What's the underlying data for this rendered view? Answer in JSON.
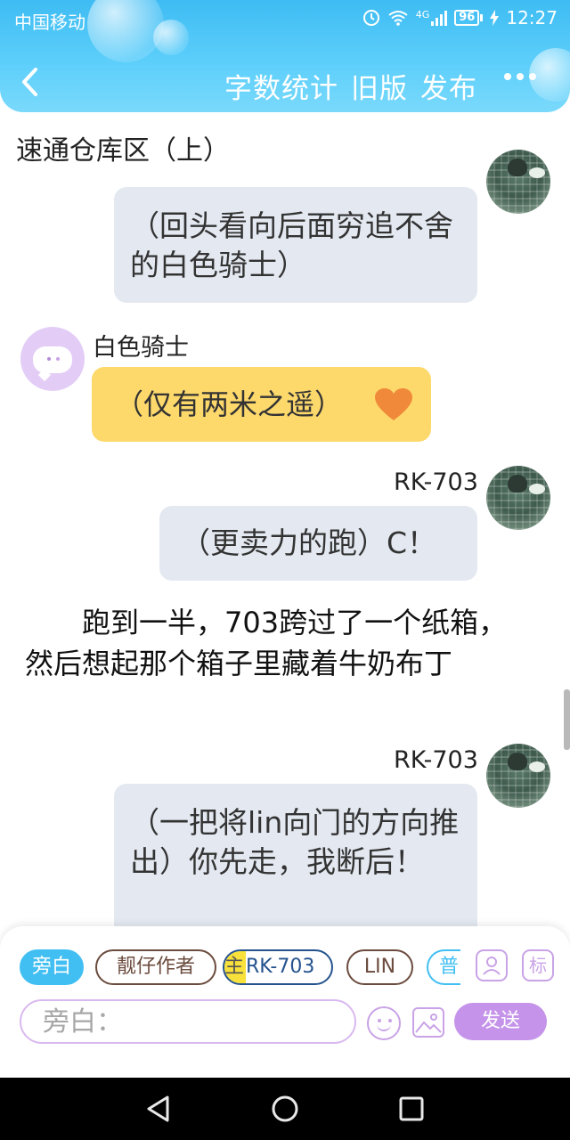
{
  "status_bar": {
    "carrier": "中国移动",
    "network": "4G",
    "battery": "96",
    "time": "12:27"
  },
  "toolbar": {
    "word_count": "字数统计",
    "old_version": "旧版",
    "publish": "发布"
  },
  "chapter_title": "速通仓库区（上）",
  "messages": [
    {
      "speaker": "",
      "text": "（回头看向后面穷追不舍的白色骑士）",
      "side": "right"
    },
    {
      "speaker": "白色骑士",
      "text": "（仅有两米之遥）",
      "emoji": "orange-heart",
      "side": "left"
    },
    {
      "speaker": "RK-703",
      "text": "（更卖力的跑）C！",
      "side": "right"
    }
  ],
  "narration": "跑到一半，703跨过了一个纸箱，然后想起那个箱子里藏着牛奶布丁",
  "last_message": {
    "speaker": "RK-703",
    "text": "（一把将lin向门的方向推出）你先走，我断后！"
  },
  "composer": {
    "roles": [
      "旁白",
      "靓仔作者",
      "RK-703",
      "LIN",
      "普"
    ],
    "main_tag": "主",
    "tool_tag": "标",
    "input_placeholder": "旁白：",
    "send_label": "发送"
  },
  "colors": {
    "header": "#3ebcf3",
    "bubble_grey": "#e4e9f1",
    "bubble_yellow": "#fdd96c",
    "accent_purple": "#c594ea"
  }
}
